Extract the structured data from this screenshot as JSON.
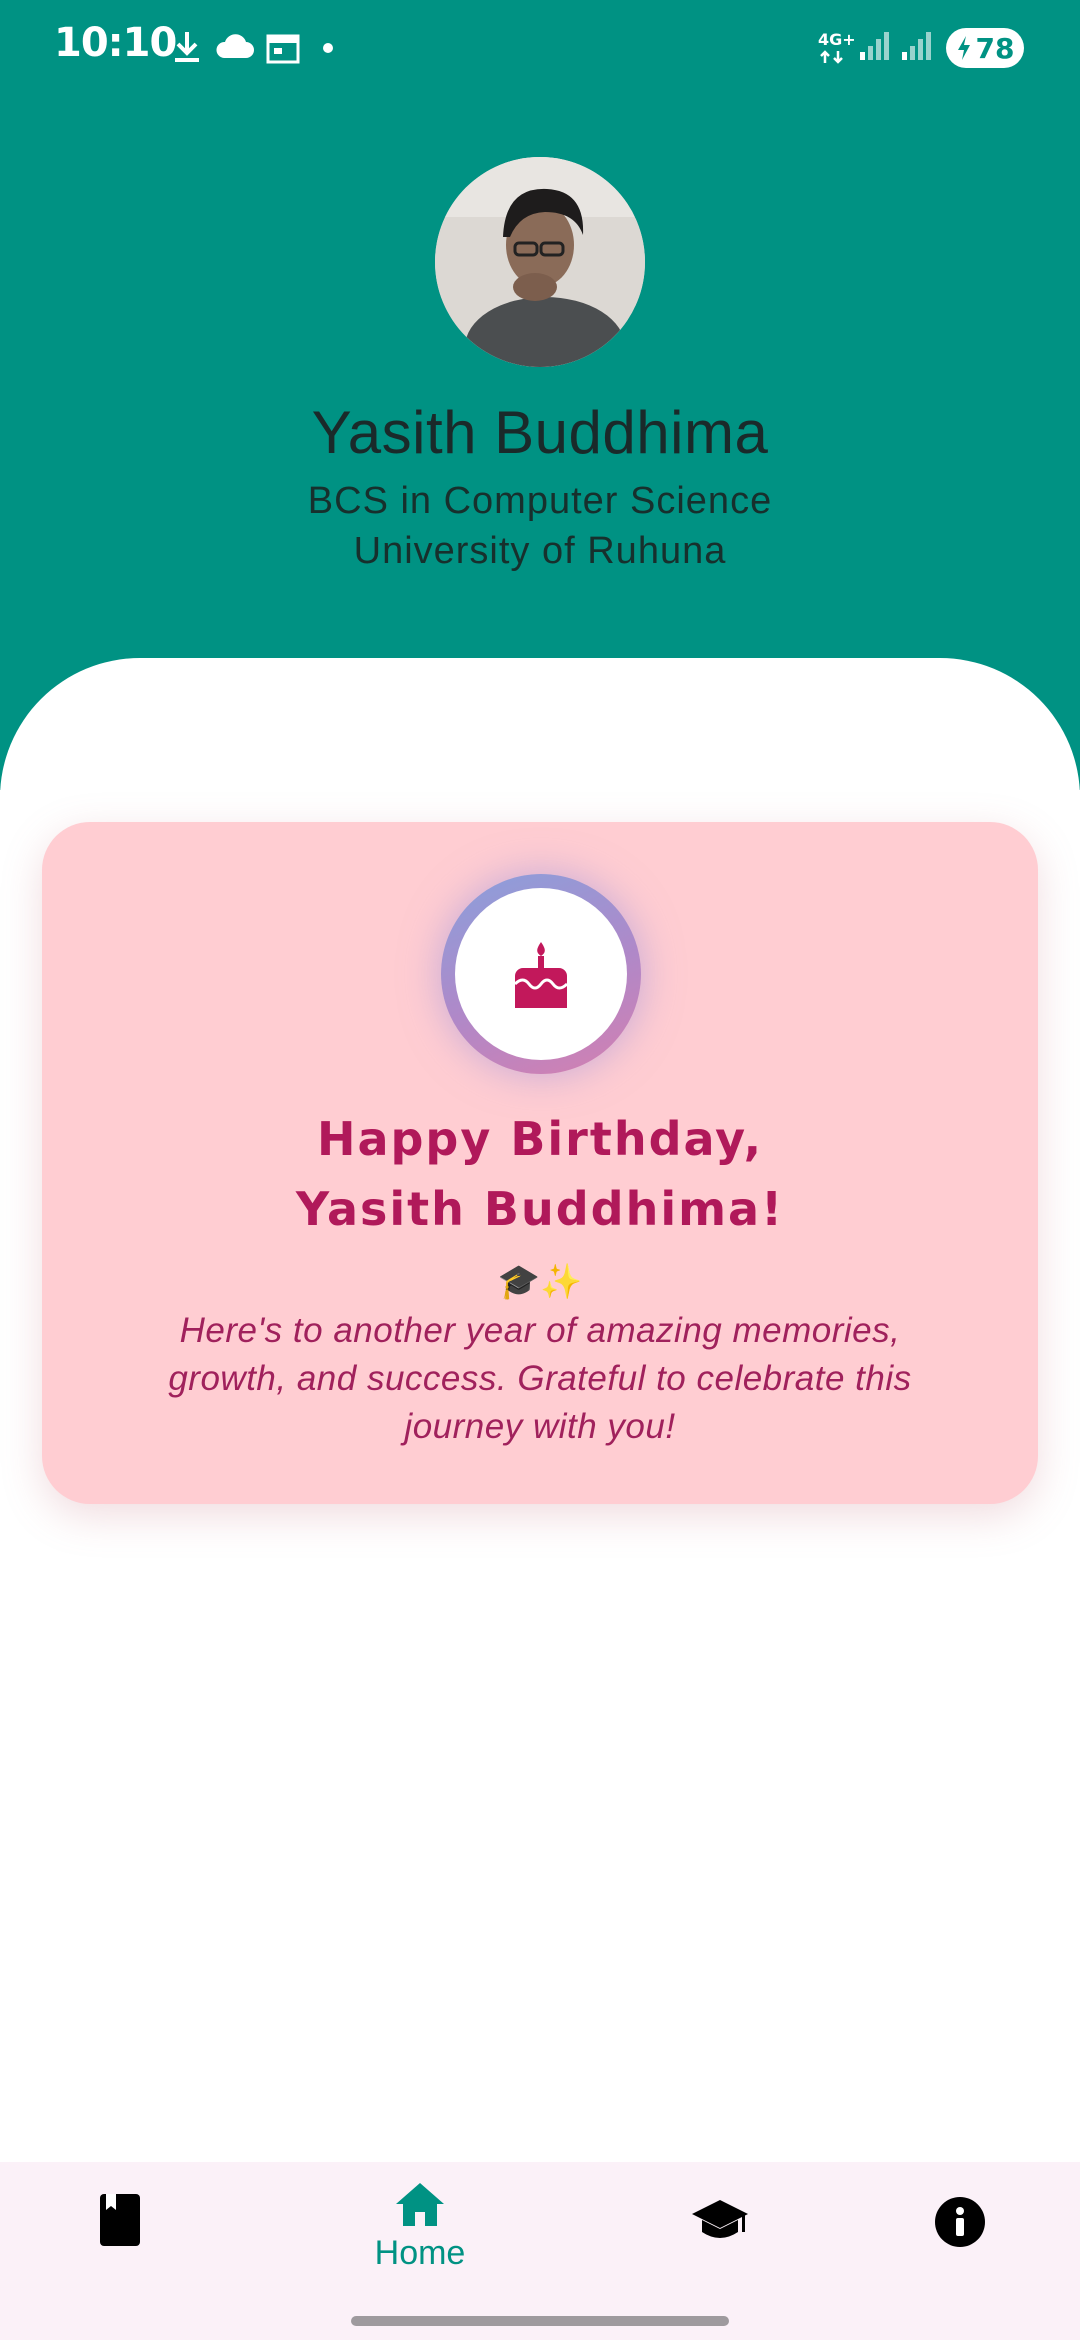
{
  "status_bar": {
    "time": "10:10",
    "network": "4G+",
    "battery": "78"
  },
  "profile": {
    "name": "Yasith Buddhima",
    "degree": "BCS in Computer Science",
    "university": "University of Ruhuna"
  },
  "card": {
    "icon": "birthday-cake-icon",
    "title_line1": "Happy Birthday,",
    "title_line2": "Yasith Buddhima!",
    "emoji": "🎓✨",
    "message": "Here's to another year of amazing memories, growth, and success. Grateful to celebrate this journey with you!"
  },
  "bottom_nav": {
    "items": [
      {
        "icon": "book-icon",
        "label": ""
      },
      {
        "icon": "home-icon",
        "label": "Home",
        "active": true
      },
      {
        "icon": "graduation-cap-icon",
        "label": ""
      },
      {
        "icon": "info-icon",
        "label": ""
      }
    ]
  },
  "colors": {
    "header": "#009283",
    "card_bg": "#ffcdd2",
    "card_text": "#b0195a",
    "nav_bg": "#fbf1f8",
    "active": "#009283"
  }
}
